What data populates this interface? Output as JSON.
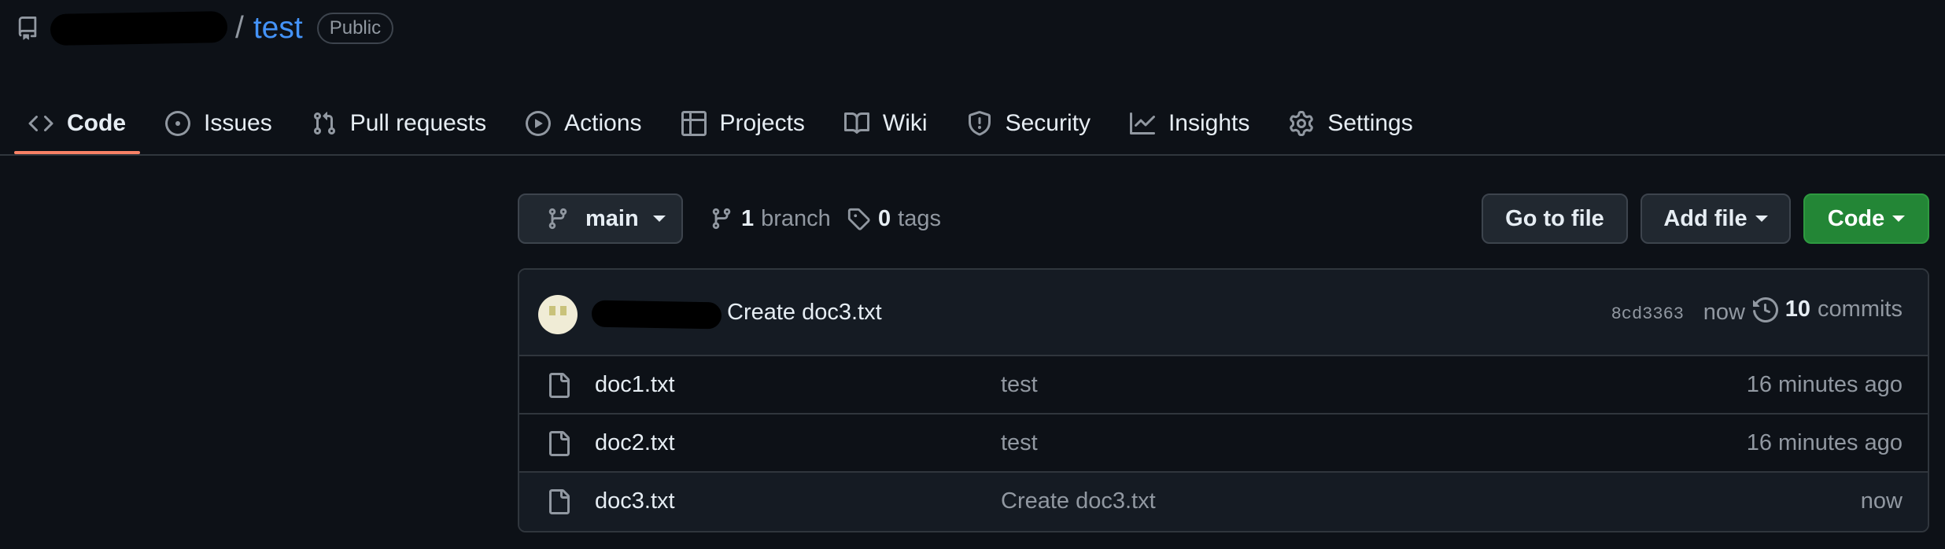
{
  "repo": {
    "separator": "/",
    "name": "test",
    "visibility": "Public"
  },
  "tabs": [
    {
      "label": "Code",
      "icon": "code-icon",
      "selected": true
    },
    {
      "label": "Issues",
      "icon": "issue-opened-icon"
    },
    {
      "label": "Pull requests",
      "icon": "git-pull-request-icon"
    },
    {
      "label": "Actions",
      "icon": "play-icon"
    },
    {
      "label": "Projects",
      "icon": "table-icon"
    },
    {
      "label": "Wiki",
      "icon": "book-icon"
    },
    {
      "label": "Security",
      "icon": "shield-icon"
    },
    {
      "label": "Insights",
      "icon": "graph-icon"
    },
    {
      "label": "Settings",
      "icon": "gear-icon"
    }
  ],
  "toolbar": {
    "branch": "main",
    "branch_count": "1",
    "branch_label": "branch",
    "tag_count": "0",
    "tag_label": "tags",
    "go_to_file": "Go to file",
    "add_file": "Add file",
    "code": "Code"
  },
  "latest_commit": {
    "message": "Create doc3.txt",
    "sha": "8cd3363",
    "time": "now",
    "commit_count": "10",
    "commit_label": "commits"
  },
  "files": [
    {
      "name": "doc1.txt",
      "commit": "test",
      "age": "16 minutes ago"
    },
    {
      "name": "doc2.txt",
      "commit": "test",
      "age": "16 minutes ago"
    },
    {
      "name": "doc3.txt",
      "commit": "Create doc3.txt",
      "age": "now"
    }
  ],
  "colors": {
    "background": "#0d1117",
    "accent_link": "#4493f8",
    "tab_underline": "#f78166",
    "primary_button": "#238636"
  }
}
